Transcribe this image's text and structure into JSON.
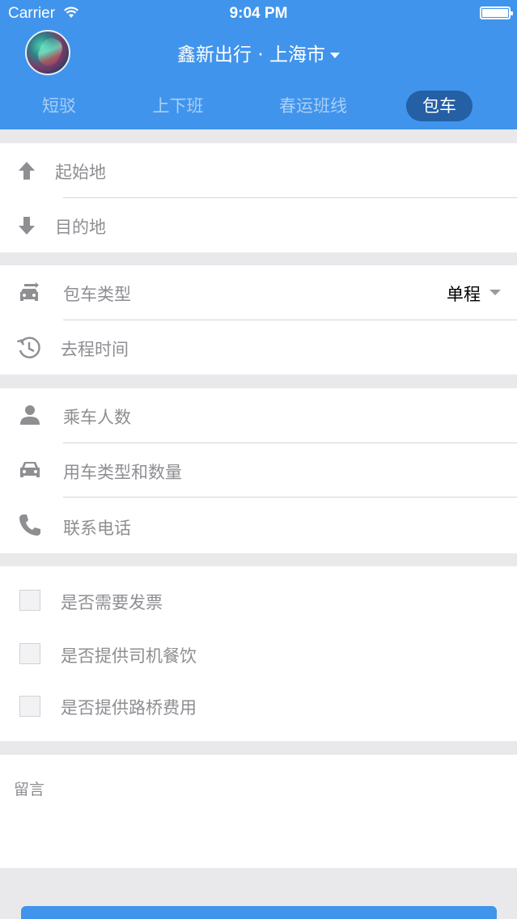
{
  "status_bar": {
    "carrier": "Carrier",
    "time": "9:04 PM"
  },
  "header": {
    "title": "鑫新出行 · 上海市",
    "tabs": [
      {
        "label": "短驳",
        "active": false
      },
      {
        "label": "上下班",
        "active": false
      },
      {
        "label": "春运班线",
        "active": false
      },
      {
        "label": "包车",
        "active": true
      }
    ],
    "accent_color": "#4094ec",
    "active_tab_color": "#255fa4"
  },
  "route": {
    "origin_placeholder": "起始地",
    "destination_placeholder": "目的地"
  },
  "charter": {
    "type_label": "包车类型",
    "type_value": "单程",
    "departure_time_label": "去程时间"
  },
  "details": {
    "passenger_count_label": "乘车人数",
    "vehicle_type_label": "用车类型和数量",
    "contact_phone_label": "联系电话"
  },
  "options": {
    "invoice_label": "是否需要发票",
    "driver_meal_label": "是否提供司机餐饮",
    "toll_label": "是否提供路桥费用"
  },
  "message": {
    "placeholder": "留言"
  },
  "icons": {
    "origin": "arrow-up-icon",
    "destination": "arrow-down-icon",
    "charter_type": "car-swap-icon",
    "time": "clock-icon",
    "passenger": "person-icon",
    "vehicle": "car-icon",
    "phone": "phone-icon"
  }
}
